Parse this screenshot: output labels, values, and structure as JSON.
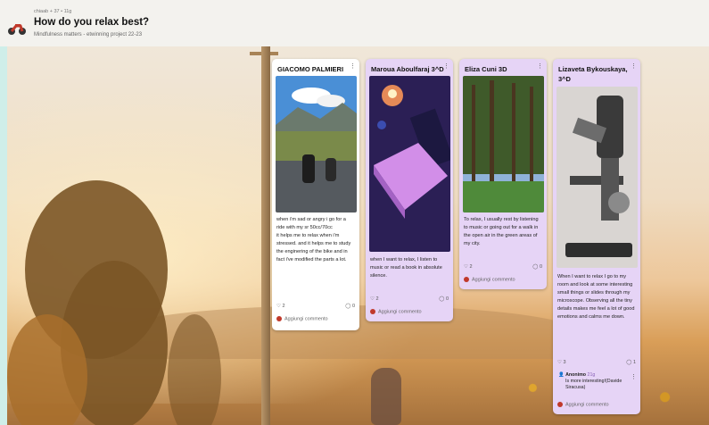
{
  "header": {
    "meta": "chiaab + 37 • 11g",
    "title": "How do you relax best?",
    "subtitle": "Mindfulness matters - etwinning project 22-23"
  },
  "cards": [
    {
      "name": "GIACOMO PALMIERI",
      "text": "when i'm sad or angry i go for a ride with my sr 50cc/70cc\nit helps me to relax when i'm stressed. and it helps me to study the enginering of the bike and in fact i've modified the parts a lot.",
      "likes": "2",
      "comments": "0",
      "add_comment": "Aggiungi commento"
    },
    {
      "name": "Maroua Aboulfaraj 3^D",
      "text": "when I want to relax, I listen to music or read a book in absolute silence.",
      "likes": "2",
      "comments": "0",
      "add_comment": "Aggiungi commento"
    },
    {
      "name": "Eliza Cuni 3D",
      "text": "To relax, I usually rest by listening to music or going out for a walk in the open air in the green areas of my city.",
      "likes": "2",
      "comments": "0",
      "add_comment": "Aggiungi commento"
    },
    {
      "name": "Lizaveta Bykouskaya, 3^D",
      "text": "When I want to relax I go to my room and look at some interesting small things or slides through my microscope. Observing all the tiny details makes me feel a lot of good emotions and calms me down.",
      "likes": "3",
      "comments": "1",
      "comment": {
        "author": "Anonimo",
        "time": "21g",
        "text": "Is more interesting!(Davide Siracusa)"
      },
      "add_comment": "Aggiungi commento"
    }
  ],
  "colors": {
    "card_lilac": "#e6d4f6",
    "card_white": "#ffffff",
    "header_bg": "#f3f2ee"
  }
}
